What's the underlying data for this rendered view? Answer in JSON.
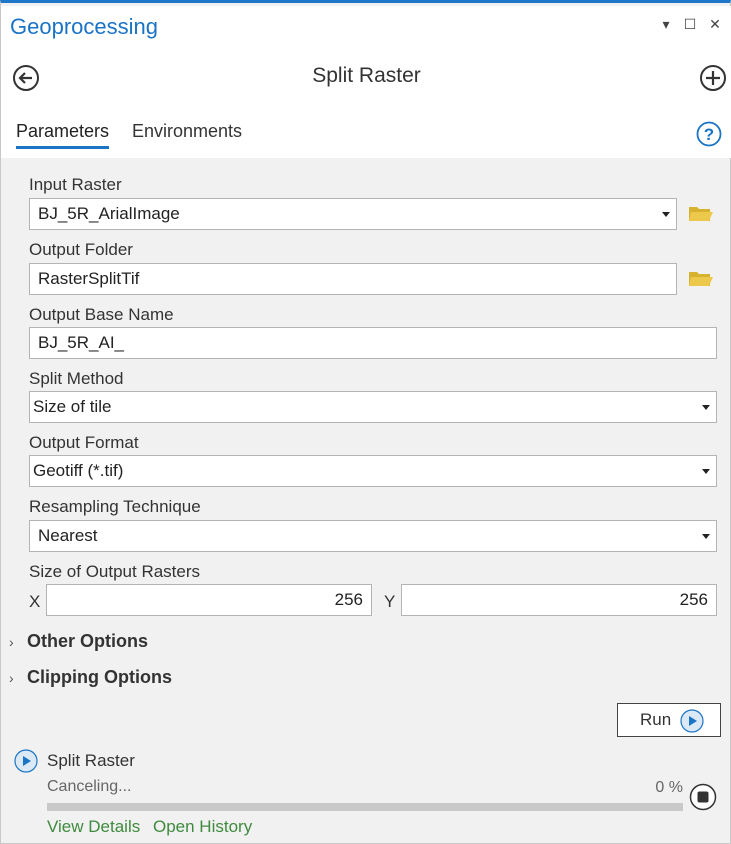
{
  "window": {
    "title": "Geoprocessing",
    "menu_glyph": "▾",
    "maximize_glyph": "☐",
    "close_glyph": "✕"
  },
  "tool": {
    "title": "Split Raster"
  },
  "tabs": [
    {
      "label": "Parameters",
      "active": true
    },
    {
      "label": "Environments",
      "active": false
    }
  ],
  "params": {
    "input_raster": {
      "label": "Input Raster",
      "value": "BJ_5R_ArialImage"
    },
    "output_folder": {
      "label": "Output Folder",
      "value": "RasterSplitTif"
    },
    "output_base_name": {
      "label": "Output Base Name",
      "value": "BJ_5R_AI_"
    },
    "split_method": {
      "label": "Split Method",
      "value": "Size of tile"
    },
    "output_format": {
      "label": "Output Format",
      "value": "Geotiff (*.tif)"
    },
    "resampling": {
      "label": "Resampling Technique",
      "value": "Nearest"
    },
    "size": {
      "label": "Size of Output Rasters",
      "x_label": "X",
      "x_value": "256",
      "y_label": "Y",
      "y_value": "256"
    }
  },
  "sections": {
    "other_options": "Other Options",
    "clipping_options": "Clipping Options",
    "chevron": "›"
  },
  "run": {
    "label": "Run"
  },
  "status": {
    "tool_name": "Split Raster",
    "state": "Canceling...",
    "percent_text": "0 %",
    "progress_fraction": 0
  },
  "links": {
    "view_details": "View Details",
    "open_history": "Open History"
  },
  "colors": {
    "accent": "#1a74c6",
    "link_green": "#3f8a3f",
    "folder_yellow": "#e0bf3a"
  },
  "icons": [
    "back-arrow-icon",
    "add-icon",
    "help-icon",
    "folder-icon",
    "play-icon",
    "stop-icon",
    "chevron-right-icon"
  ]
}
